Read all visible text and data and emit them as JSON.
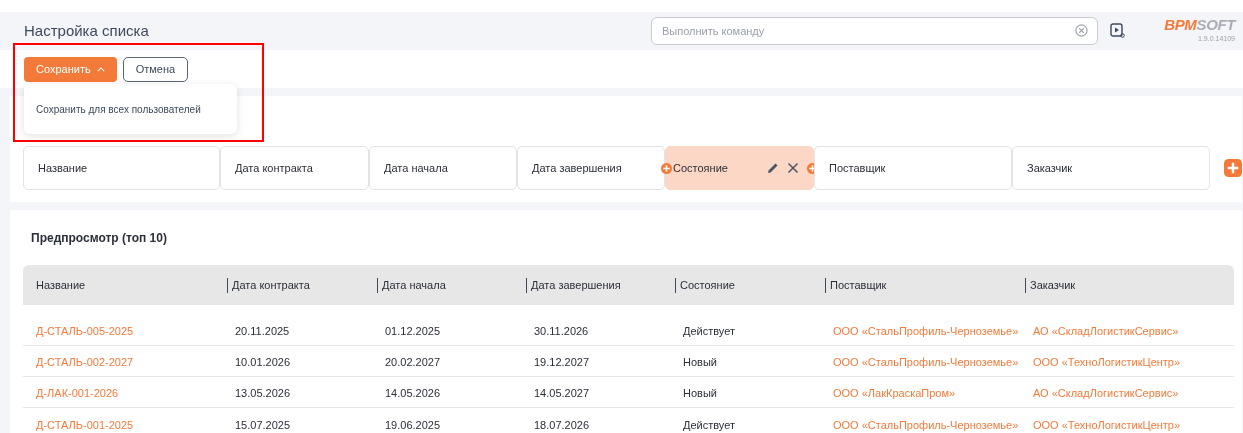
{
  "header": {
    "title": "Настройка списка",
    "command": {
      "placeholder": "Выполнить команду"
    },
    "logo": {
      "accent": "BPM",
      "rest": "SOFT"
    },
    "version": "1.9.0.14109"
  },
  "toolbar": {
    "save": "Сохранить",
    "save_expanded": true,
    "cancel": "Отмена",
    "menu": [
      "Сохранить для всех пользователей"
    ],
    "highlighted": true
  },
  "columns": [
    {
      "label": "Название",
      "selected": false
    },
    {
      "label": "Дата контракта",
      "selected": false
    },
    {
      "label": "Дата начала",
      "selected": false
    },
    {
      "label": "Дата завершения",
      "selected": false
    },
    {
      "label": "Состояние",
      "selected": true
    },
    {
      "label": "Поставщик",
      "selected": false
    },
    {
      "label": "Заказчик",
      "selected": false
    }
  ],
  "preview": {
    "title": "Предпросмотр (топ 10)",
    "headers": [
      {
        "label": "Название",
        "link": true
      },
      {
        "label": "Дата контракта",
        "link": false
      },
      {
        "label": "Дата начала",
        "link": false
      },
      {
        "label": "Дата завершения",
        "link": false
      },
      {
        "label": "Состояние",
        "link": false
      },
      {
        "label": "Поставщик",
        "link": true
      },
      {
        "label": "Заказчик",
        "link": true
      }
    ],
    "rows": [
      [
        "Д-СТАЛЬ-005-2025",
        "20.11.2025",
        "01.12.2025",
        "30.11.2026",
        "Действует",
        "ООО «СтальПрофиль-Черноземье»",
        "АО «СкладЛогистикСервис»"
      ],
      [
        "Д-СТАЛЬ-002-2027",
        "10.01.2026",
        "20.02.2027",
        "19.12.2027",
        "Новый",
        "ООО «СтальПрофиль-Черноземье»",
        "ООО «ТехноЛогистикЦентр»"
      ],
      [
        "Д-ЛАК-001-2026",
        "13.05.2026",
        "14.05.2026",
        "14.05.2027",
        "Новый",
        "ООО «ЛакКраскаПром»",
        "АО «СкладЛогистикСервис»"
      ],
      [
        "Д-СТАЛЬ-001-2025",
        "15.07.2025",
        "19.06.2025",
        "18.07.2026",
        "Действует",
        "ООО «СтальПрофиль-Черноземье»",
        "ООО «ТехноЛогистикЦентр»"
      ]
    ]
  }
}
